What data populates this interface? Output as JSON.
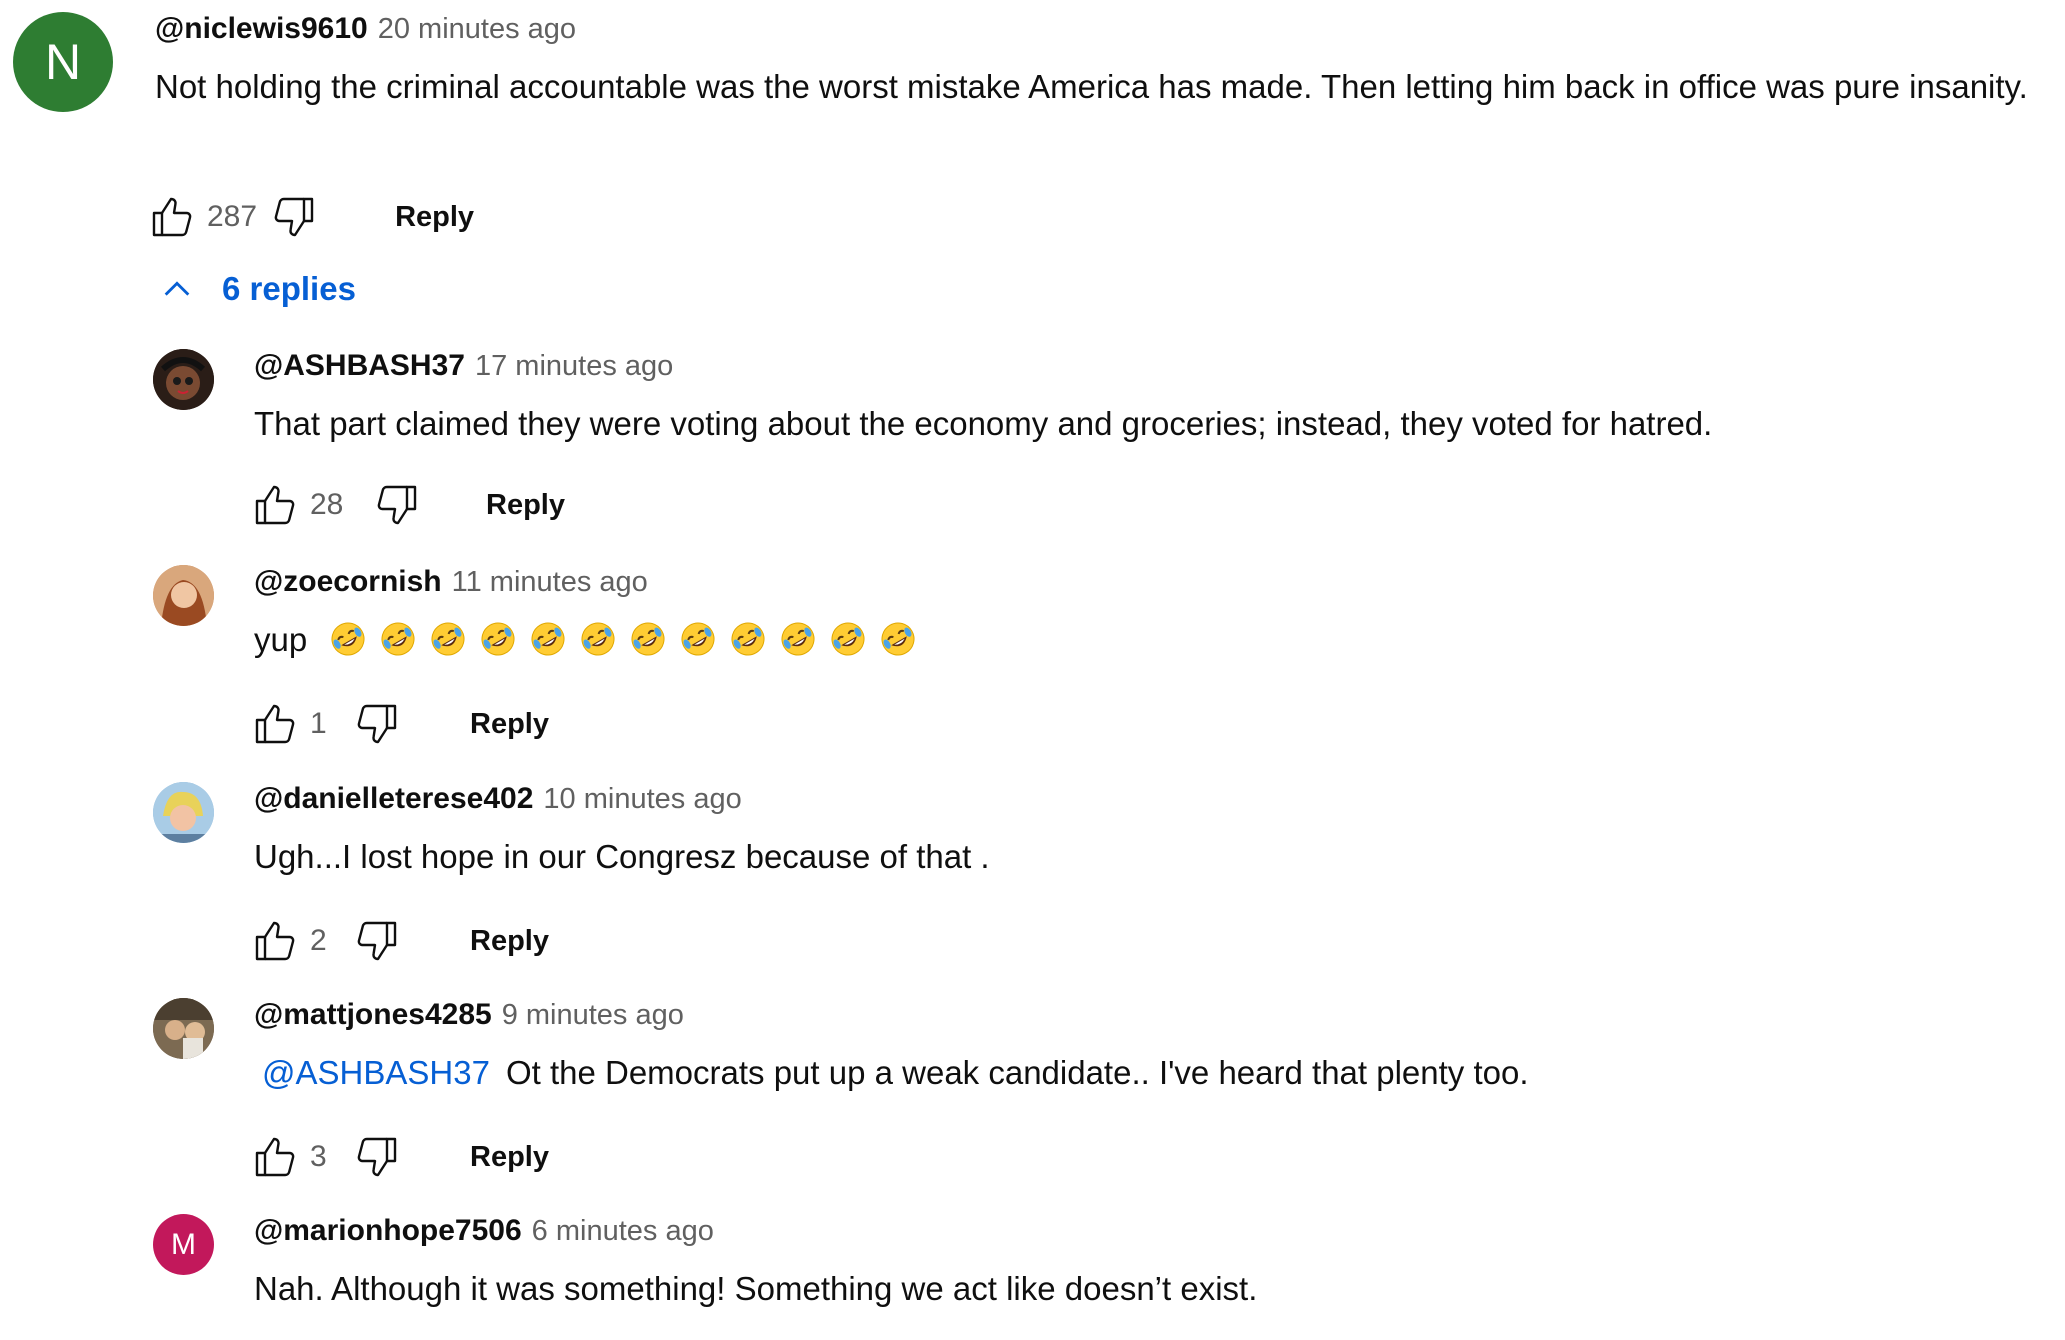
{
  "top_comment": {
    "avatar_letter": "N",
    "avatar_color": "#2e7d32",
    "author": "@niclewis9610",
    "timestamp": "20 minutes ago",
    "text": "Not holding the criminal accountable was the worst mistake America has made. Then letting him back in office was pure insanity.",
    "likes": "287",
    "reply_label": "Reply"
  },
  "replies_toggle": {
    "label": "6 replies",
    "icon": "chevron-up-icon"
  },
  "replies": [
    {
      "author": "@ASHBASH37",
      "timestamp": "17 minutes ago",
      "text": "That part claimed they were voting about the economy and groceries; instead, they voted for hatred.",
      "likes": "28",
      "reply_label": "Reply",
      "avatar_color": "#3a2a22"
    },
    {
      "author": "@zoecornish",
      "timestamp": "11 minutes ago",
      "text": "yup",
      "emoji_count": 12,
      "emoji": "rolling-on-floor-laughing-emoji",
      "likes": "1",
      "reply_label": "Reply",
      "avatar_color": "#c8895a"
    },
    {
      "author": "@danielleterese402",
      "timestamp": "10 minutes ago",
      "text": "Ugh...I lost hope in our Congresz because of that .",
      "likes": "2",
      "reply_label": "Reply",
      "avatar_color": "#8fb8d8"
    },
    {
      "author": "@mattjones4285",
      "timestamp": "9 minutes ago",
      "mention": "@ASHBASH37",
      "text": "Ot the Democrats put up a weak candidate.. I've heard that plenty too.",
      "likes": "3",
      "reply_label": "Reply",
      "avatar_color": "#6b5a44"
    },
    {
      "author": "@marionhope7506",
      "timestamp": "6 minutes ago",
      "text": "Nah. Although it was something! Something we act like doesn’t exist.",
      "avatar_letter": "M",
      "avatar_color": "#c2185b"
    }
  ],
  "colors": {
    "link_blue": "#065fd4",
    "meta_gray": "#606060",
    "text": "#0f0f0f"
  }
}
